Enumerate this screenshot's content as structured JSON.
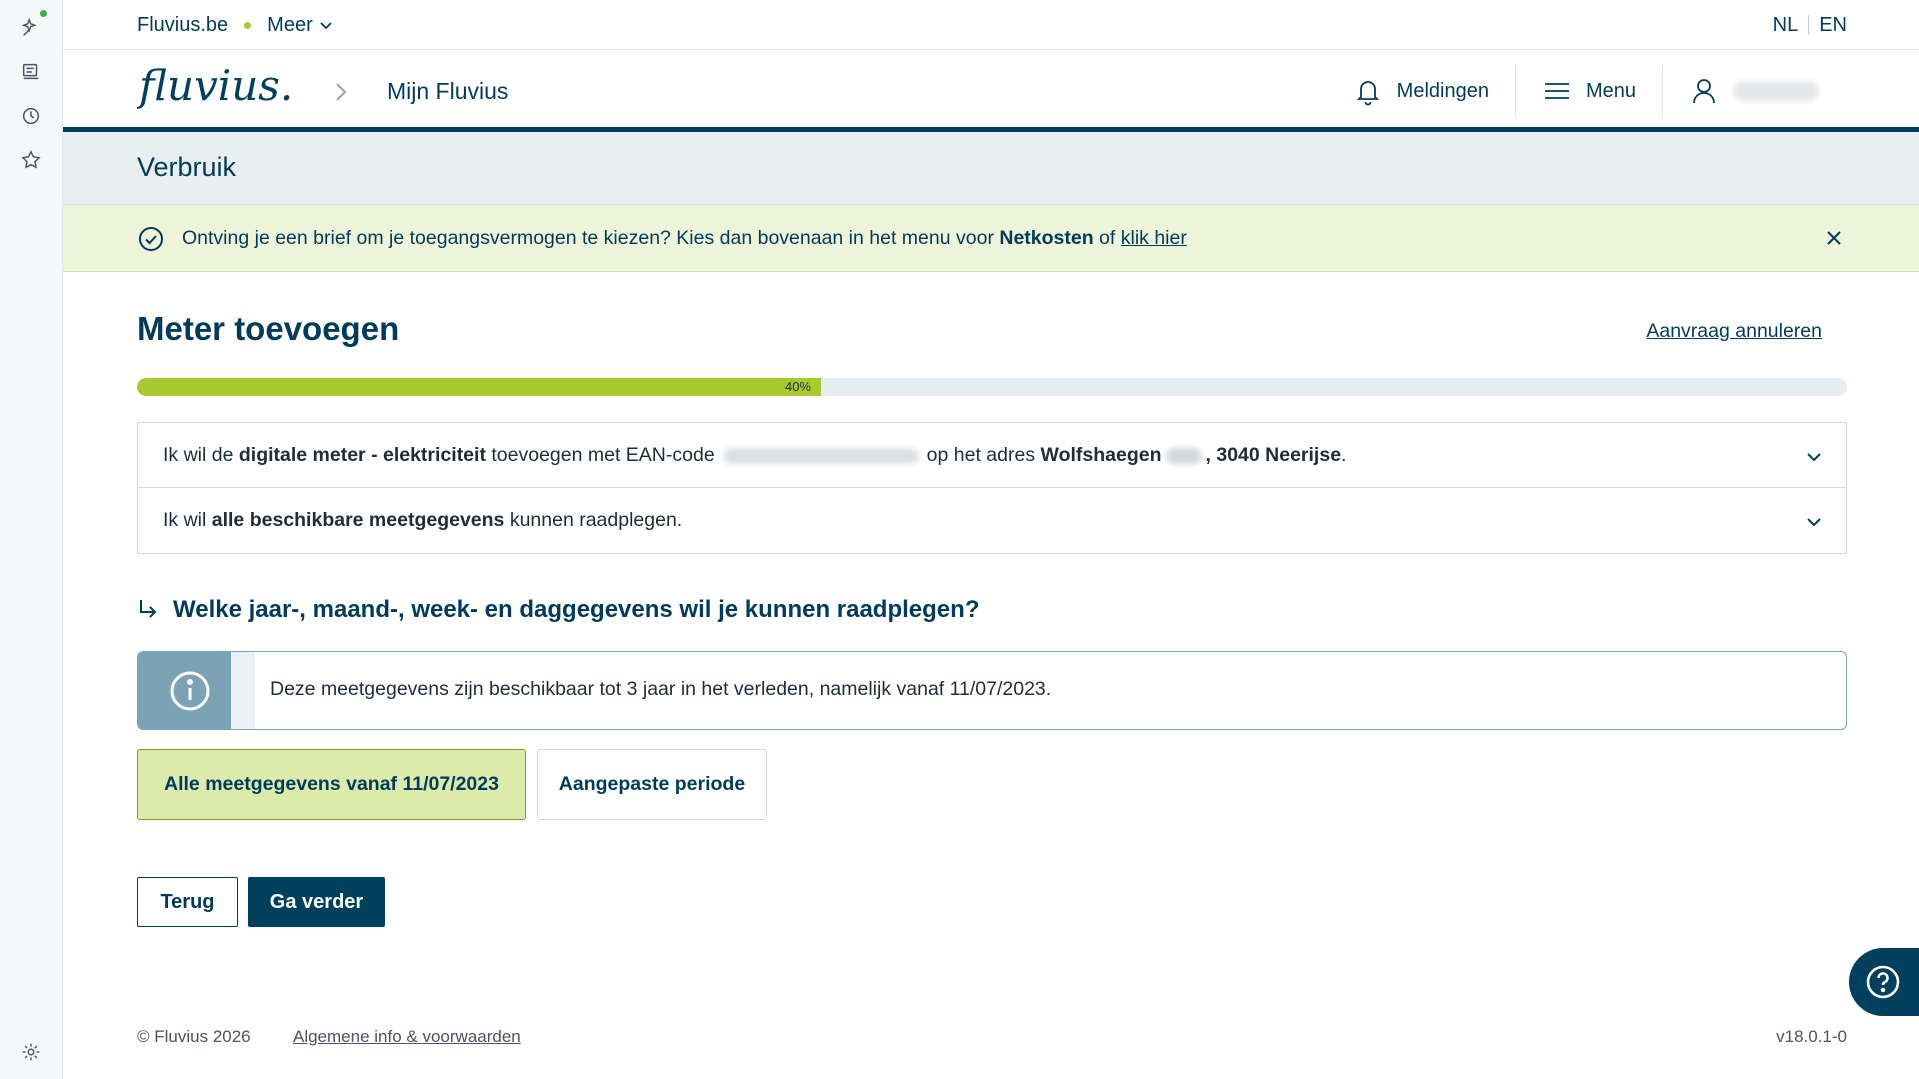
{
  "utility": {
    "site": "Fluvius.be",
    "more": "Meer",
    "lang_nl": "NL",
    "lang_en": "EN"
  },
  "header": {
    "logo_text": "fluvius.",
    "breadcrumb": "Mijn Fluvius",
    "notifications": "Meldingen",
    "menu": "Menu",
    "user_name": ""
  },
  "page": {
    "section_title": "Verbruik"
  },
  "notice": {
    "prefix": "Ontving je een brief om je toegangsvermogen te kiezen? Kies dan bovenaan in het menu voor ",
    "bold": "Netkosten",
    "middle": " of ",
    "link": "klik hier"
  },
  "wizard": {
    "title": "Meter toevoegen",
    "cancel": "Aanvraag annuleren",
    "progress_percent": 40,
    "progress_label": "40%",
    "step1": {
      "a": "Ik wil de ",
      "b": "digitale meter - elektriciteit",
      "c": " toevoegen met EAN-code",
      "d": "op het adres ",
      "e": "Wolfshaegen",
      "f": ", 3040 Neerijse",
      "g": "."
    },
    "step2": {
      "a": "Ik wil ",
      "b": "alle beschikbare meetgegevens",
      "c": " kunnen raadplegen."
    },
    "question": "Welke jaar-, maand-, week- en daggegevens wil je kunnen raadplegen?",
    "info": "Deze meetgegevens zijn beschikbaar tot 3 jaar in het verleden, namelijk vanaf 11/07/2023.",
    "option_all": "Alle meetgegevens vanaf 11/07/2023",
    "option_custom": "Aangepaste periode",
    "back": "Terug",
    "next": "Ga verder"
  },
  "footer": {
    "copyright": "© Fluvius 2026",
    "terms": "Algemene info & voorwaarden",
    "version": "v18.0.1-0"
  },
  "colors": {
    "brand_dark": "#00405f",
    "brand_green": "#a7cb2f",
    "notice_bg": "#eef4d9",
    "band_bg": "#e9eef1"
  }
}
